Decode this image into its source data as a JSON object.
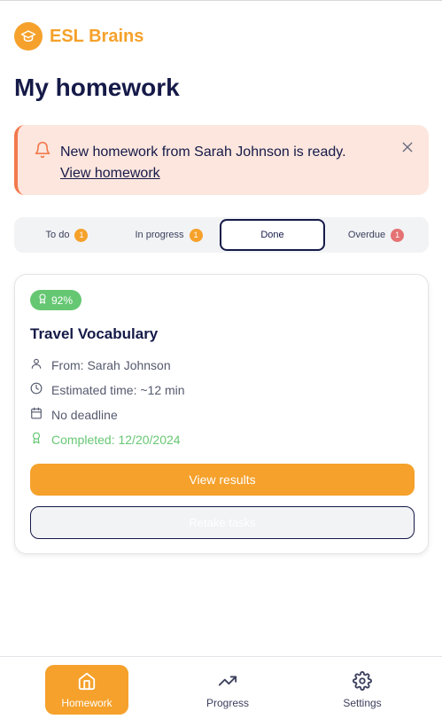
{
  "brand": {
    "name": "ESL Brains",
    "logo_icon": "graduation-cap-icon",
    "color": "#f5a12b"
  },
  "page": {
    "title": "My homework"
  },
  "alert": {
    "message": "New homework from Sarah Johnson is ready.",
    "link_label": "View homework",
    "icon": "bell-icon",
    "accent": "#f27a4e"
  },
  "tabs": [
    {
      "label": "To do",
      "count": "1",
      "badge_color": "#f5a12b"
    },
    {
      "label": "In progress",
      "count": "1",
      "badge_color": "#f5a12b"
    },
    {
      "label": "Done",
      "active": true
    },
    {
      "label": "Overdue",
      "count": "1",
      "badge_color": "#e57373"
    }
  ],
  "card": {
    "score": "92%",
    "title": "Travel Vocabulary",
    "from": "From: Sarah Johnson",
    "time": "Estimated time: ~12 min",
    "deadline": "No deadline",
    "completed": "Completed: 12/20/2024",
    "primary_button": "View results",
    "secondary_button": "Retake tasks"
  },
  "nav": {
    "items": [
      {
        "label": "Homework",
        "icon": "home-icon",
        "active": true
      },
      {
        "label": "Progress",
        "icon": "trending-up-icon"
      },
      {
        "label": "Settings",
        "icon": "gear-icon"
      }
    ]
  }
}
